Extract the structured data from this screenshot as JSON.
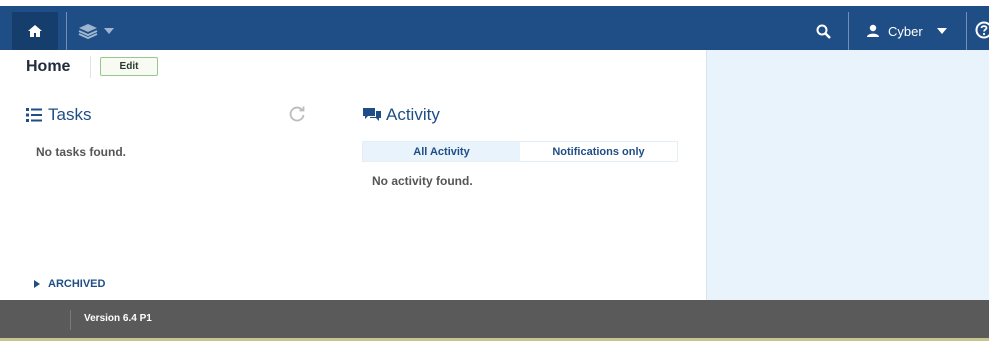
{
  "topbar": {
    "user_label": "Cyber"
  },
  "page": {
    "title": "Home",
    "edit_label": "Edit"
  },
  "tasks": {
    "heading": "Tasks",
    "empty_text": "No tasks found.",
    "archived_label": "ARCHIVED"
  },
  "activity": {
    "heading": "Activity",
    "tabs": [
      {
        "label": "All Activity",
        "active": true
      },
      {
        "label": "Notifications only",
        "active": false
      }
    ],
    "empty_text": "No activity found."
  },
  "footer": {
    "version": "Version 6.4 P1"
  },
  "colors": {
    "topbar": "#1f4e86",
    "accent": "#1f4e86",
    "right_pane": "#e8f3fc",
    "footer": "#5a5a5a"
  }
}
